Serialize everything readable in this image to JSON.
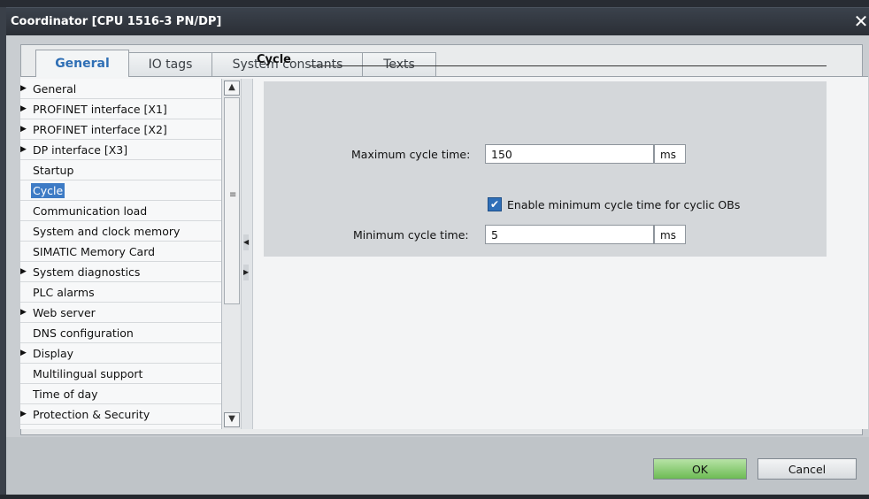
{
  "window": {
    "title": "Coordinator [CPU 1516-3 PN/DP]",
    "close_glyph": "✕"
  },
  "tabs": [
    {
      "label": "General",
      "active": true
    },
    {
      "label": "IO tags",
      "active": false
    },
    {
      "label": "System constants",
      "active": false
    },
    {
      "label": "Texts",
      "active": false
    }
  ],
  "nav": {
    "items": [
      {
        "label": "General",
        "expandable": true
      },
      {
        "label": "PROFINET interface [X1]",
        "expandable": true
      },
      {
        "label": "PROFINET interface [X2]",
        "expandable": true
      },
      {
        "label": "DP interface [X3]",
        "expandable": true
      },
      {
        "label": "Startup",
        "expandable": false
      },
      {
        "label": "Cycle",
        "expandable": false,
        "selected": true
      },
      {
        "label": "Communication load",
        "expandable": false
      },
      {
        "label": "System and clock memory",
        "expandable": false
      },
      {
        "label": "SIMATIC Memory Card",
        "expandable": false
      },
      {
        "label": "System diagnostics",
        "expandable": true
      },
      {
        "label": "PLC alarms",
        "expandable": false
      },
      {
        "label": "Web server",
        "expandable": true
      },
      {
        "label": "DNS configuration",
        "expandable": false
      },
      {
        "label": "Display",
        "expandable": true
      },
      {
        "label": "Multilingual support",
        "expandable": false
      },
      {
        "label": "Time of day",
        "expandable": false
      },
      {
        "label": "Protection & Security",
        "expandable": true
      }
    ]
  },
  "cycle": {
    "section_title": "Cycle",
    "max_label": "Maximum cycle time:",
    "max_value": "150",
    "max_unit": "ms",
    "enable_min_label": "Enable minimum cycle time for cyclic OBs",
    "enable_min_checked": true,
    "min_label": "Minimum cycle time:",
    "min_value": "5",
    "min_unit": "ms"
  },
  "buttons": {
    "ok": "OK",
    "cancel": "Cancel"
  },
  "colors": {
    "accent": "#2f6fb5",
    "selection": "#3d7bc5",
    "ok_green": "#6dbb54"
  }
}
